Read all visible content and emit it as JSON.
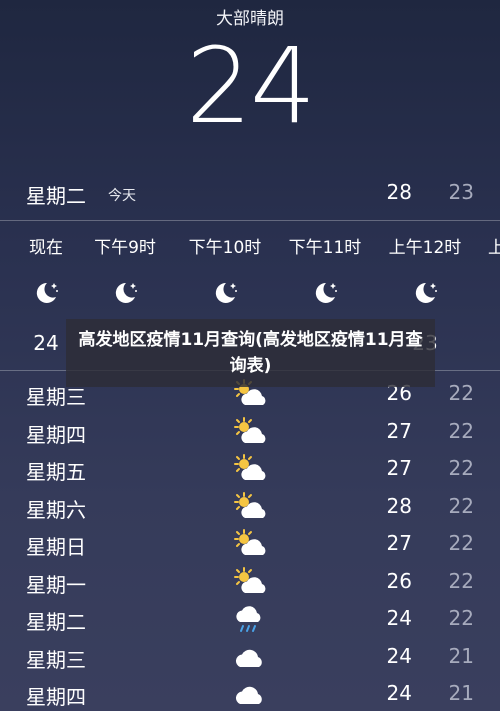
{
  "location": {
    "condition": "大部晴朗",
    "temperature": "24"
  },
  "today": {
    "day": "星期二",
    "tag": "今天",
    "high": "28",
    "low": "23"
  },
  "hourly": [
    {
      "label": "现在",
      "icon": "moon-stars-icon",
      "temp": "24"
    },
    {
      "label": "下午9时",
      "icon": "moon-stars-icon",
      "temp": ""
    },
    {
      "label": "下午10时",
      "icon": "moon-stars-icon",
      "temp": ""
    },
    {
      "label": "下午11时",
      "icon": "moon-stars-icon",
      "temp": ""
    },
    {
      "label": "上午12时",
      "icon": "moon-stars-icon",
      "temp": "23"
    }
  ],
  "daily": [
    {
      "day": "星期三",
      "icon": "partly-sunny-icon",
      "high": "26",
      "low": "22"
    },
    {
      "day": "星期四",
      "icon": "partly-sunny-icon",
      "high": "27",
      "low": "22"
    },
    {
      "day": "星期五",
      "icon": "partly-sunny-icon",
      "high": "27",
      "low": "22"
    },
    {
      "day": "星期六",
      "icon": "partly-sunny-icon",
      "high": "28",
      "low": "22"
    },
    {
      "day": "星期日",
      "icon": "partly-sunny-icon",
      "high": "27",
      "low": "22"
    },
    {
      "day": "星期一",
      "icon": "partly-sunny-icon",
      "high": "26",
      "low": "22"
    },
    {
      "day": "星期二",
      "icon": "rain-cloud-icon",
      "high": "24",
      "low": "22"
    },
    {
      "day": "星期三",
      "icon": "cloud-icon",
      "high": "24",
      "low": "21"
    },
    {
      "day": "星期四",
      "icon": "cloud-icon",
      "high": "24",
      "low": "21"
    }
  ],
  "banner": {
    "text": "高发地区疫情11月查询(高发地区疫情11月查询表)"
  },
  "colors": {
    "background_top": "#1f2740",
    "background_bottom": "#3a3f5e",
    "low_temp": "#a7abbd",
    "sun": "#f5c542",
    "rain": "#4aa3e8"
  }
}
